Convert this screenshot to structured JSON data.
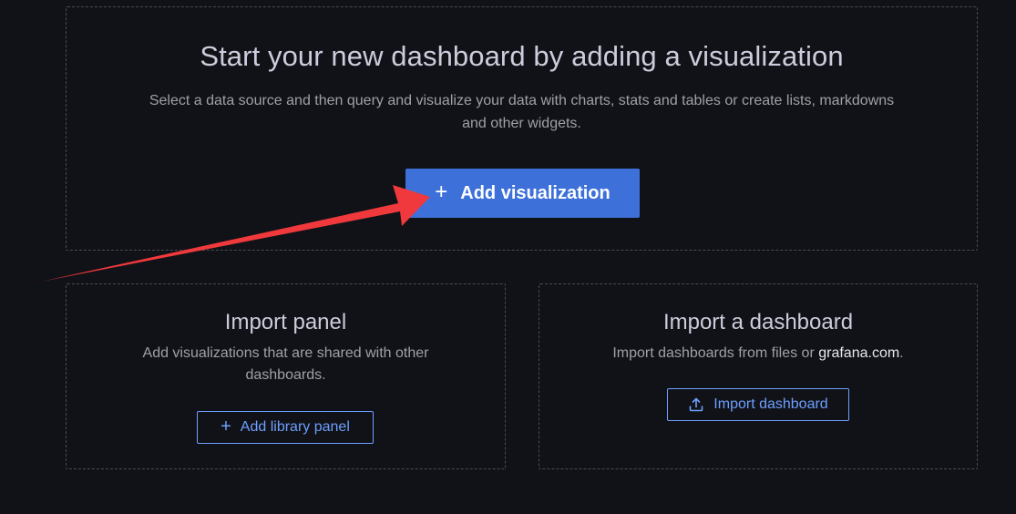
{
  "hero": {
    "title": "Start your new dashboard by adding a visualization",
    "description": "Select a data source and then query and visualize your data with charts, stats and tables or create lists, markdowns and other widgets.",
    "button_label": "Add visualization"
  },
  "import_panel": {
    "title": "Import panel",
    "description": "Add visualizations that are shared with other dashboards.",
    "button_label": "Add library panel"
  },
  "import_dashboard": {
    "title": "Import a dashboard",
    "description_prefix": "Import dashboards from files or ",
    "description_link": "grafana.com",
    "description_suffix": ".",
    "button_label": "Import dashboard"
  },
  "colors": {
    "background": "#111217",
    "primary": "#3d71d9",
    "outline": "#6e9fff",
    "annotation_arrow": "#f0393c"
  },
  "icons": {
    "add": "plus-icon",
    "import": "upload-icon"
  }
}
